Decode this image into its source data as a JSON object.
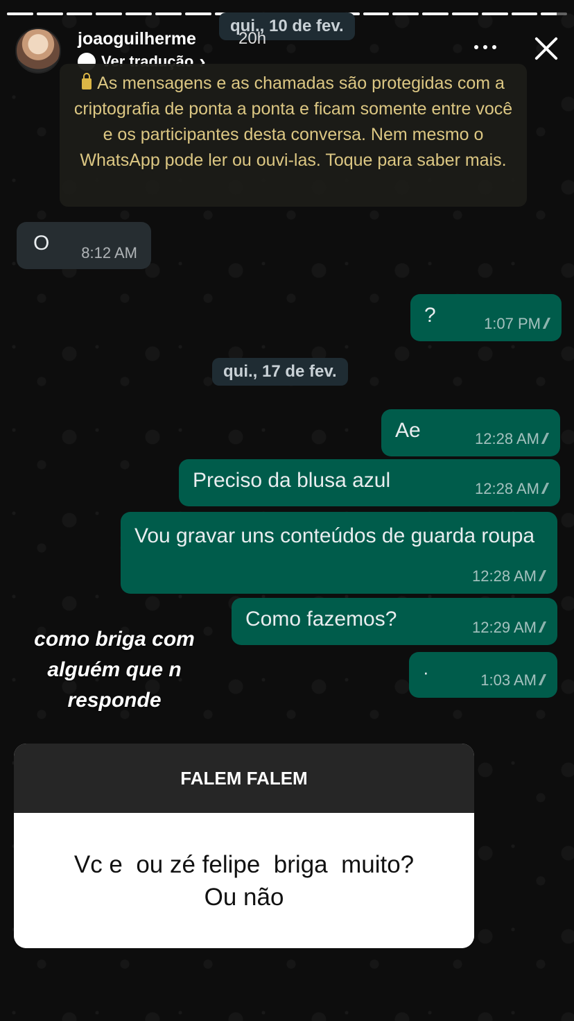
{
  "story": {
    "username": "joaoguilherme",
    "time_ago": "20h",
    "translate_label": "Ver tradução",
    "translate_chevron": "›",
    "caption": "como briga com alguém que n responde",
    "progress": [
      1,
      1,
      1,
      1,
      1,
      1,
      1,
      1,
      1,
      1,
      1,
      1,
      1,
      1,
      1,
      1,
      1,
      1,
      0.6
    ]
  },
  "chat": {
    "date_chip_1": "qui., 10 de fev.",
    "date_chip_2": "qui., 17 de fev.",
    "encryption_notice": "As mensagens e as chamadas são protegidas com a criptografia de ponta a ponta e ficam somente entre você e os participantes desta conversa. Nem mesmo o WhatsApp pode ler ou ouvi-las. Toque para saber mais.",
    "messages": [
      {
        "direction": "in",
        "text": "O",
        "time": "8:12 AM"
      },
      {
        "direction": "out",
        "text": "?",
        "time": "1:07 PM"
      },
      {
        "direction": "out",
        "text": "Ae",
        "time": "12:28 AM"
      },
      {
        "direction": "out",
        "text": "Preciso da blusa azul",
        "time": "12:28 AM"
      },
      {
        "direction": "out",
        "text": "Vou gravar uns conteúdos de guarda roupa",
        "time": "12:28 AM"
      },
      {
        "direction": "out",
        "text": "Como fazemos?",
        "time": "12:29 AM"
      },
      {
        "direction": "out",
        "text": "·",
        "time": "1:03 AM"
      }
    ],
    "read_ticks": "//"
  },
  "question": {
    "header": "FALEM FALEM",
    "body": "Vc e  ou zé felipe  briga  muito?\nOu não"
  },
  "colors": {
    "outgoing_bubble": "#005c4b",
    "incoming_bubble": "#262d31",
    "notice_text": "#e8d28a"
  }
}
